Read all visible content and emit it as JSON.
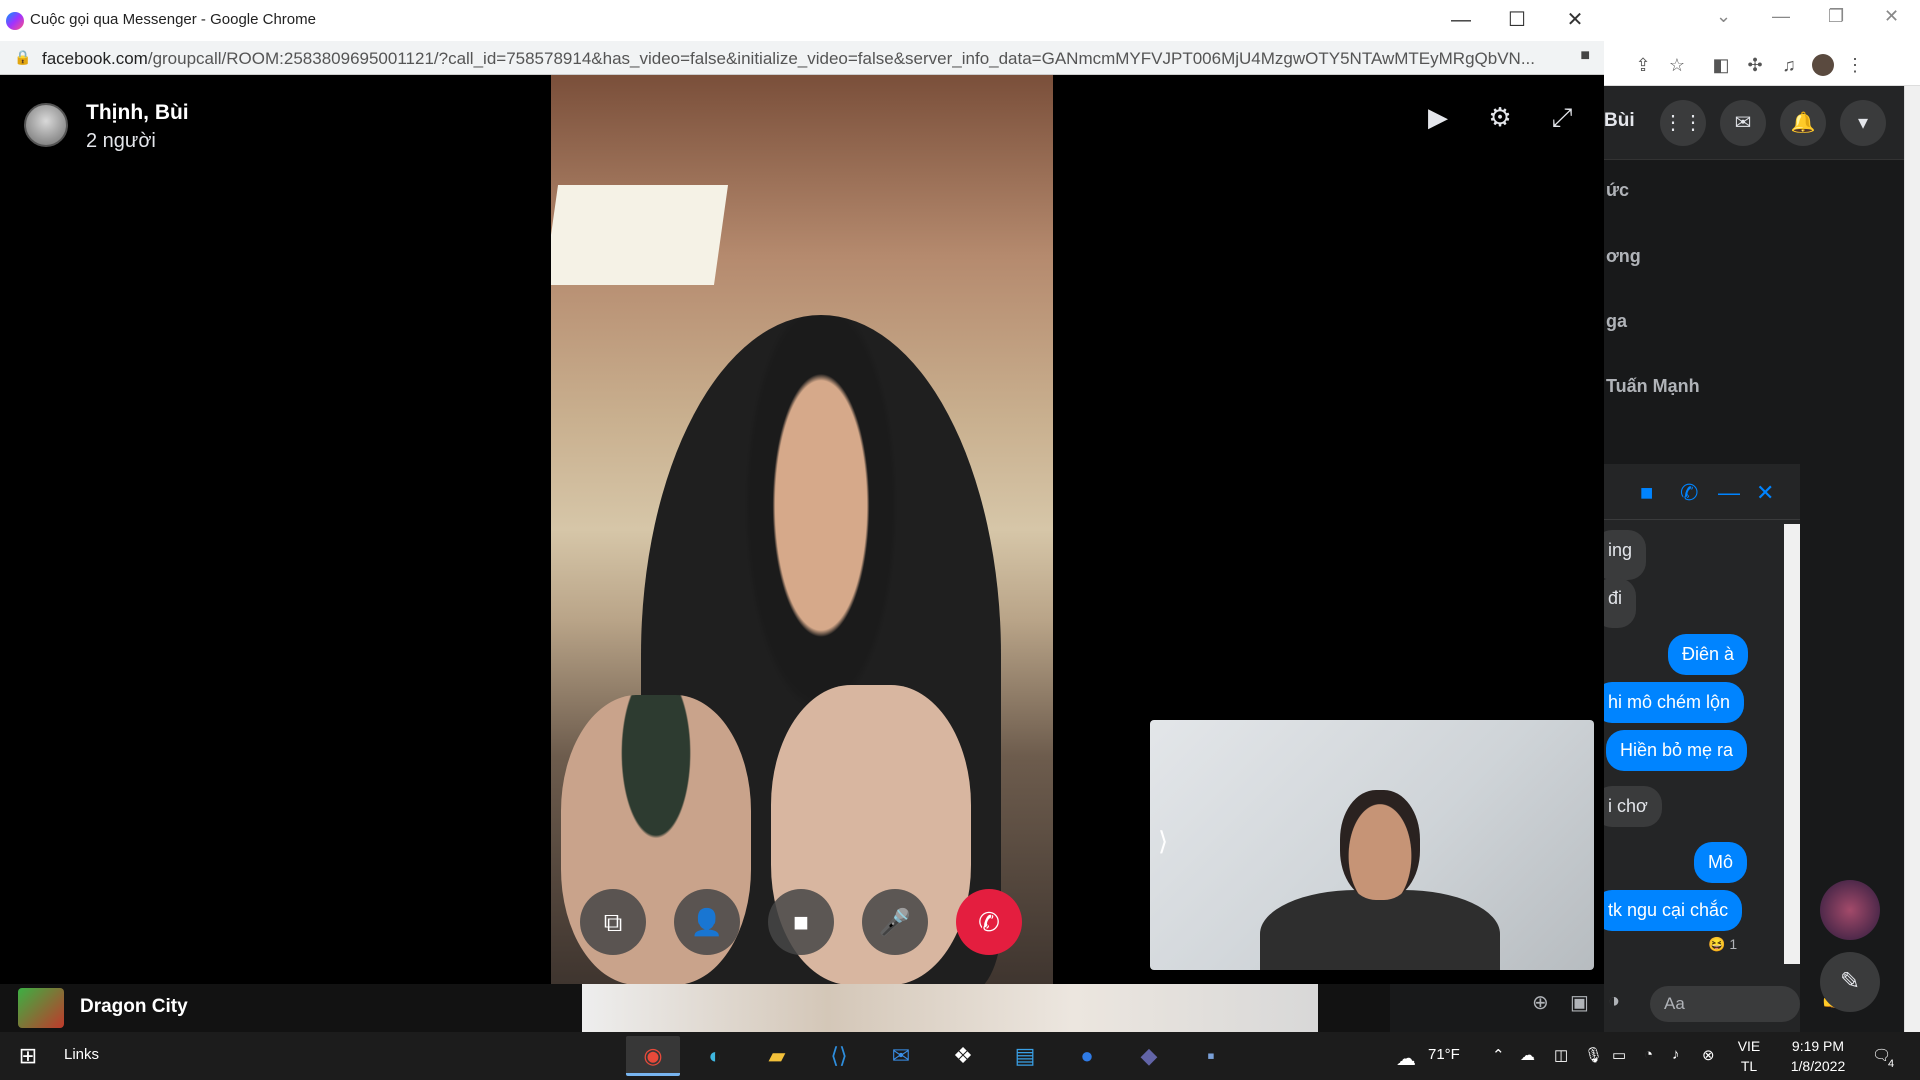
{
  "popup": {
    "window_title": "Cuộc gọi qua Messenger - Google Chrome",
    "url_host": "facebook.com",
    "url_path": "/groupcall/ROOM:2583809695001121/?call_id=758578914&has_video=false&initialize_video=false&server_info_data=GANmcmMYFVJPT006MjU4MzgwOTY5NTAwMTEyMRgQbVN..."
  },
  "call": {
    "caller_name": "Thịnh, Bùi",
    "participant_count": "2 người",
    "self_view_collapse_icon": "chevron-right-icon",
    "controls": [
      "share-screen-icon",
      "add-person-icon",
      "camera-icon",
      "microphone-icon",
      "end-call-icon"
    ],
    "end_call_color": "#e41e3f"
  },
  "background_page": {
    "header_partial_name": "Bùi",
    "contacts": [
      "ức",
      "ơng",
      "ga",
      "Tuấn Mạnh"
    ],
    "chat": {
      "messages": [
        {
          "text": "ing",
          "from": "them"
        },
        {
          "text": "đi",
          "from": "them"
        },
        {
          "text": "Điên à",
          "from": "me"
        },
        {
          "text": "hi mô chém lộn",
          "from": "me"
        },
        {
          "text": "Hiền bỏ mẹ ra",
          "from": "me"
        },
        {
          "text": "i chơ",
          "from": "them"
        },
        {
          "text": "Mô",
          "from": "me"
        },
        {
          "text": "tk ngu cại chắc",
          "from": "me"
        }
      ],
      "reaction": "😆 1",
      "input_placeholder": "Aa"
    },
    "banner_title": "Dragon City"
  },
  "taskbar": {
    "links_label": "Links",
    "weather": "71°F",
    "language": "VIE",
    "language_sub": "TL",
    "time": "9:19 PM",
    "date": "1/8/2022",
    "notification_count": "4"
  }
}
